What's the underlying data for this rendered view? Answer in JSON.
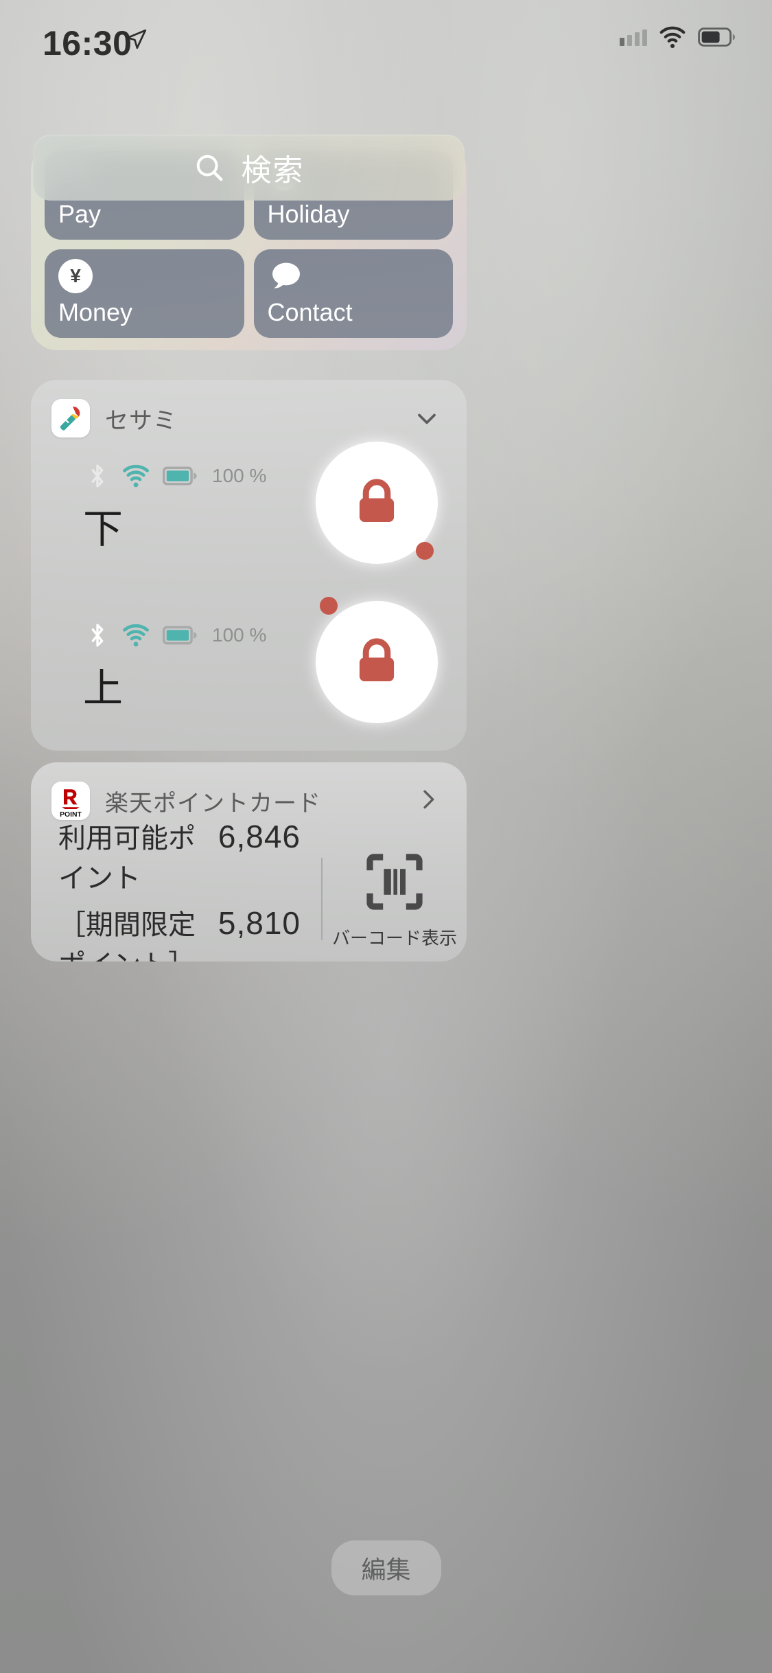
{
  "statusbar": {
    "time": "16:30",
    "location_icon": "location-arrow-icon",
    "signal_icon": "cellular-dots-icon",
    "wifi_icon": "wifi-icon",
    "battery_icon": "battery-icon"
  },
  "search": {
    "label": "検索",
    "icon": "search-icon"
  },
  "shortcuts": {
    "tiles": [
      {
        "label": "Pay",
        "icon": "qr-code-icon"
      },
      {
        "label": "Holiday",
        "icon": "moon-icon"
      },
      {
        "label": "Money",
        "icon": "yen-circle-icon",
        "glyph": "¥"
      },
      {
        "label": "Contact",
        "icon": "speech-bubble-icon"
      }
    ]
  },
  "sesame": {
    "title": "セサミ",
    "app_icon": "sesame-key-icon",
    "collapse_icon": "chevron-down-icon",
    "locks": [
      {
        "name": "下",
        "bluetooth_state": "off",
        "wifi_state": "on",
        "battery_state": "full",
        "battery_text": "100 %",
        "lock_state": "locked",
        "lock_icon": "padlock-closed-icon",
        "dot_position": "bottom-right"
      },
      {
        "name": "上",
        "bluetooth_state": "on",
        "wifi_state": "on",
        "battery_state": "full",
        "battery_text": "100 %",
        "lock_state": "locked",
        "lock_icon": "padlock-closed-icon",
        "dot_position": "top-left"
      }
    ]
  },
  "rakuten": {
    "title": "楽天ポイントカード",
    "app_icon": "rakuten-point-icon",
    "logo_letter": "R",
    "logo_sub": "POINT",
    "disclosure_icon": "chevron-right-icon",
    "rows": [
      {
        "label": "利用可能ポイント",
        "value": "6,846"
      },
      {
        "label": "［期間限定ポイント］",
        "value": "5,810"
      }
    ],
    "barcode": {
      "icon": "barcode-scan-icon",
      "caption": "バーコード表示"
    }
  },
  "footer": {
    "edit_label": "編集"
  },
  "colors": {
    "lock_red": "#c4584c",
    "teal": "#4fb3ae",
    "tile_grey": "#7c8390",
    "rakuten_red": "#bf0000"
  }
}
